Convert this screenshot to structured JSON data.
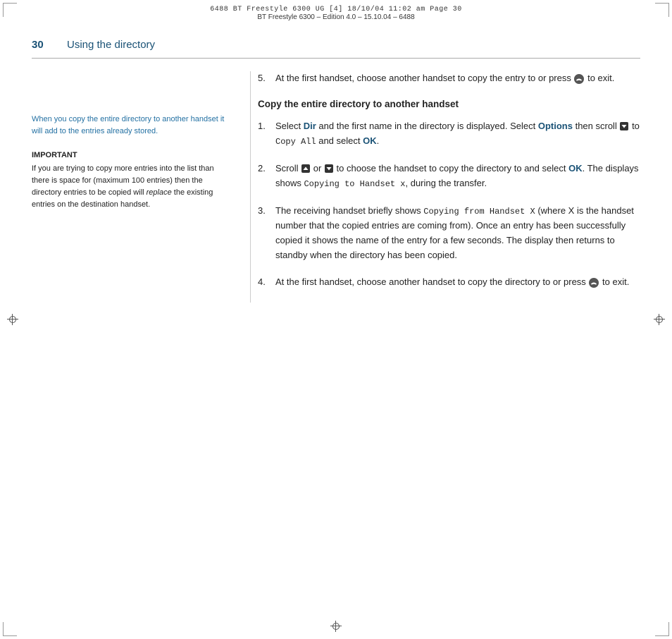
{
  "header": {
    "line1": "6488 BT Freestyle 6300 UG [4]   18/10/04  11:02 am  Page 30",
    "line2": "BT Freestyle 6300 – Edition 4.0 – 15.10.04 – 6488"
  },
  "page": {
    "number": "30",
    "chapter": "Using the directory"
  },
  "left_col": {
    "note": "When you copy the entire directory to another handset it will add to the entries already stored.",
    "important_label": "IMPORTANT",
    "important_body": "If you are trying to copy more entries into the list than there is space for (maximum 100 entries) then the directory entries to be copied will replace the existing entries on the destination handset."
  },
  "right_col": {
    "step5": {
      "num": "5.",
      "text_before": "At the first handset, choose another handset to copy the entry to or press",
      "text_after": "to exit."
    },
    "section_heading": "Copy the entire directory to another handset",
    "step1": {
      "num": "1.",
      "text_part1": "Select",
      "dir": "Dir",
      "text_part2": "and the first name in the directory is displayed. Select",
      "options": "Options",
      "text_part3": "then scroll",
      "mono1": "Copy All",
      "text_part4": "and select",
      "ok1": "OK",
      "text_part5": "."
    },
    "step2": {
      "num": "2.",
      "text_part1": "Scroll",
      "text_part2": "or",
      "text_part3": "to choose the handset to copy the directory to and select",
      "ok2": "OK",
      "text_part4": ". The displays shows",
      "mono2": "Copying to Handset x",
      "text_part5": ", during the transfer."
    },
    "step3": {
      "num": "3.",
      "text_part1": "The receiving handset briefly shows",
      "mono3": "Copying from Handset X",
      "text_part2": "(where X is the handset number that the copied entries are coming from). Once an entry has been successfully copied it shows the name of the entry for a few seconds. The display then returns to standby when the directory has been copied."
    },
    "step4": {
      "num": "4.",
      "text_part1": "At the first handset, choose another handset to copy the directory to or press",
      "text_part2": "to exit."
    }
  }
}
